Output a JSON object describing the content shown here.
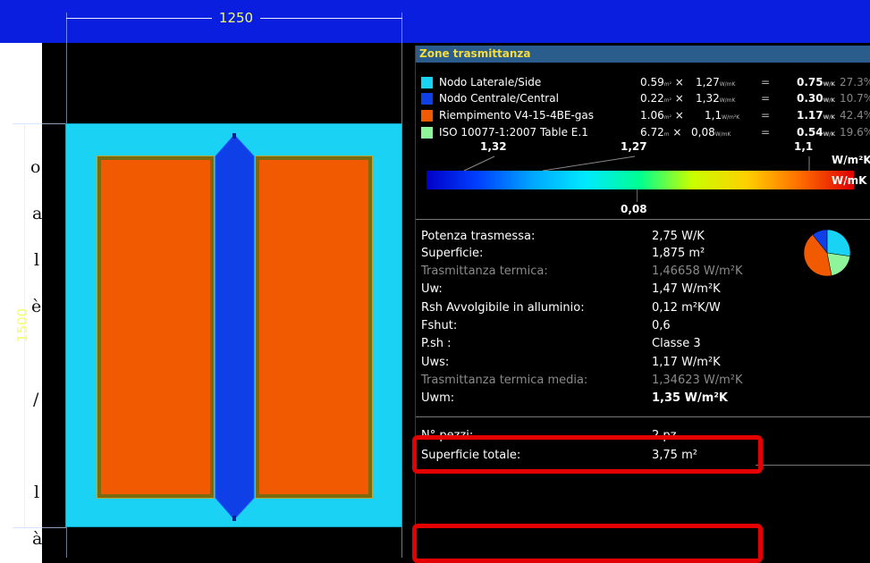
{
  "dimensions": {
    "width_label": "1250",
    "height_label": "1500"
  },
  "left_fragments": [
    "o",
    "a",
    "l",
    "è",
    "/",
    "l",
    "à"
  ],
  "panel": {
    "title": "Zone trasmittanza",
    "zones": [
      {
        "name": "Nodo Laterale/Side",
        "area": "0.59",
        "area_unit": "m²",
        "u": "1,27",
        "u_unit": "W/mK",
        "eq": "=",
        "value": "0.75",
        "value_unit": "W/K",
        "percent": "27.3%",
        "color": "#19d3f4"
      },
      {
        "name": "Nodo Centrale/Central",
        "area": "0.22",
        "area_unit": "m²",
        "u": "1,32",
        "u_unit": "W/mK",
        "eq": "=",
        "value": "0.30",
        "value_unit": "W/K",
        "percent": "10.7%",
        "color": "#0f3fe6"
      },
      {
        "name": "Riempimento V4-15-4BE-gas",
        "area": "1.06",
        "area_unit": "m²",
        "u": "1,1",
        "u_unit": "W/m²K",
        "eq": "=",
        "value": "1.17",
        "value_unit": "W/K",
        "percent": "42.4%",
        "color": "#f25a02"
      },
      {
        "name": "ISO 10077-1:2007 Table E.1",
        "area": "6.72",
        "area_unit": "m",
        "u": "0,08",
        "u_unit": "W/mK",
        "eq": "=",
        "value": "0.54",
        "value_unit": "W/K",
        "percent": "19.6%",
        "color": "#8ef59b"
      }
    ],
    "gradient": {
      "top_labels": [
        "1,32",
        "1,27",
        "1,1"
      ],
      "unit_top": "W/m²K",
      "unit_bottom": "W/mK",
      "bottom_label": "0,08"
    },
    "info": [
      {
        "label": "Potenza trasmessa:",
        "value": "2,75 W/K",
        "dim": false,
        "bold": false
      },
      {
        "label": "Superficie:",
        "value": "1,875 m²",
        "dim": false,
        "bold": false
      },
      {
        "label": "Trasmittanza termica:",
        "value": "1,46658 W/m²K",
        "dim": true,
        "bold": false
      },
      {
        "label": "Uw:",
        "value": "1,47 W/m²K",
        "dim": false,
        "bold": false
      },
      {
        "label": "Rsh Avvolgibile in alluminio:",
        "value": "0,12 m²K/W",
        "dim": false,
        "bold": false
      },
      {
        "label": "Fshut:",
        "value": "0,6",
        "dim": false,
        "bold": false
      },
      {
        "label": "P.sh :",
        "value": "Classe 3",
        "dim": false,
        "bold": false
      },
      {
        "label": "Uws:",
        "value": "1,17 W/m²K",
        "dim": false,
        "bold": false
      },
      {
        "label": "Trasmittanza termica media:",
        "value": "1,34623 W/m²K",
        "dim": true,
        "bold": false
      },
      {
        "label": "Uwm:",
        "value": "1,35 W/m²K",
        "dim": false,
        "bold": true
      }
    ],
    "pieces": {
      "label": "N° pezzi:",
      "value": "2 pz"
    },
    "total": {
      "label": "Superficie totale:",
      "value": "3,75 m²"
    },
    "pie": [
      {
        "percent": 27.3,
        "color": "#19d3f4"
      },
      {
        "percent": 19.6,
        "color": "#8ef59b"
      },
      {
        "percent": 42.4,
        "color": "#f25a02"
      },
      {
        "percent": 10.7,
        "color": "#0f3fe6"
      }
    ]
  },
  "colors": {
    "highlight": "#e40000",
    "background_blue": "#0a1ee0",
    "glass": "#f25a02",
    "frame": "#19d3f4"
  }
}
